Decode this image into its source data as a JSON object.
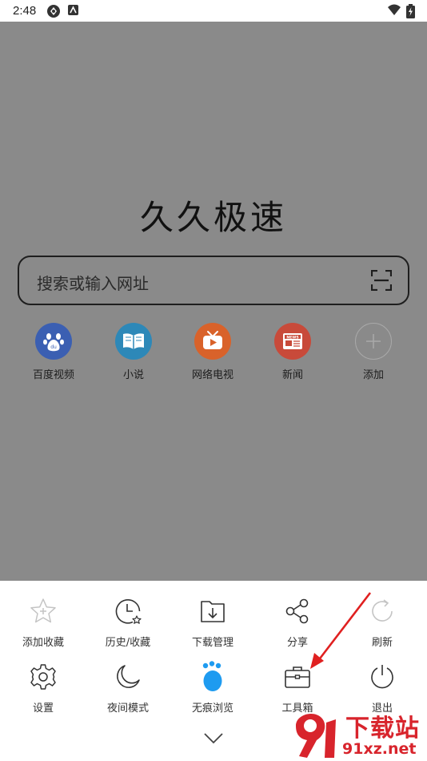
{
  "status_bar": {
    "time": "2:48"
  },
  "home": {
    "title": "久久极速",
    "search": {
      "placeholder": "搜索或输入网址"
    },
    "quick_links": [
      {
        "label": "百度视频",
        "icon": "baidu-paw-icon",
        "color": "#3b5fb2"
      },
      {
        "label": "小说",
        "icon": "book-icon",
        "color": "#2d88b8"
      },
      {
        "label": "网络电视",
        "icon": "tv-icon",
        "color": "#d9622a"
      },
      {
        "label": "新闻",
        "icon": "news-icon",
        "color": "#c84a3a"
      },
      {
        "label": "添加",
        "icon": "plus-icon",
        "color": "#a9a9a9"
      }
    ]
  },
  "menu": {
    "rows": [
      [
        {
          "label": "添加收藏",
          "icon": "star-add-icon"
        },
        {
          "label": "历史/收藏",
          "icon": "history-clock-icon"
        },
        {
          "label": "下载管理",
          "icon": "download-folder-icon"
        },
        {
          "label": "分享",
          "icon": "share-icon"
        },
        {
          "label": "刷新",
          "icon": "refresh-icon"
        }
      ],
      [
        {
          "label": "设置",
          "icon": "gear-icon"
        },
        {
          "label": "夜间模式",
          "icon": "moon-icon"
        },
        {
          "label": "无痕浏览",
          "icon": "incognito-paw-icon"
        },
        {
          "label": "工具箱",
          "icon": "toolbox-icon"
        },
        {
          "label": "退出",
          "icon": "power-icon"
        }
      ]
    ]
  },
  "watermark": {
    "text_top": "下载站",
    "text_bottom": "91xz.net",
    "brand_color": "#d8242c"
  },
  "colors": {
    "overlay": "#8a8a8a",
    "incognito": "#1e9bf0",
    "arrow": "#e02020"
  }
}
